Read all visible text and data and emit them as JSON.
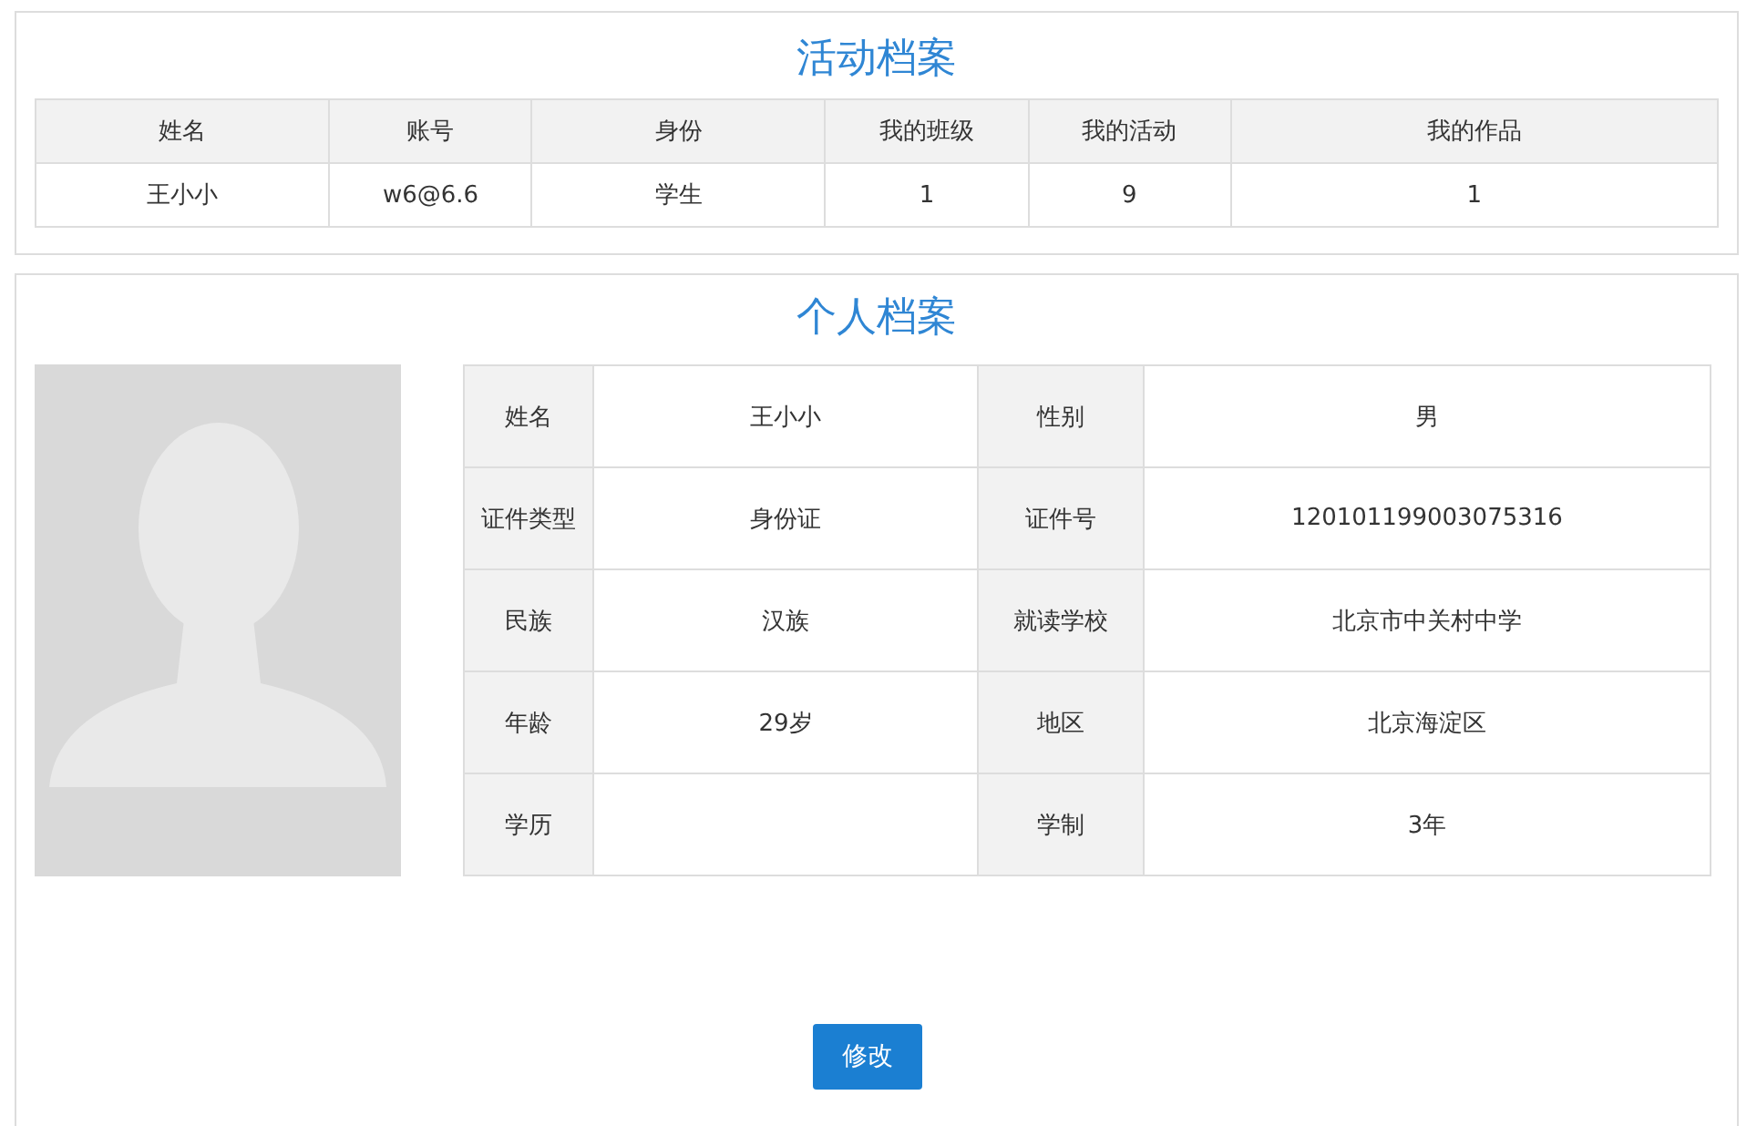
{
  "activity_archive": {
    "title": "活动档案",
    "columns": [
      "姓名",
      "账号",
      "身份",
      "我的班级",
      "我的活动",
      "我的作品"
    ],
    "row": [
      "王小小",
      "w6@6.6",
      "学生",
      "1",
      "9",
      "1"
    ]
  },
  "personal_archive": {
    "title": "个人档案",
    "rows": [
      {
        "label": "姓名",
        "value": "王小小",
        "label_2": "性别",
        "value_2": "男"
      },
      {
        "label": "证件类型",
        "value": "身份证",
        "label_2": "证件号",
        "value_2": "120101199003075316"
      },
      {
        "label": "民族",
        "value": "汉族",
        "label_2": "就读学校",
        "value_2": "北京市中关村中学"
      },
      {
        "label": "年龄",
        "value": "29岁",
        "label_2": "地区",
        "value_2": "北京海淀区"
      },
      {
        "label": "学历",
        "label_2": "学制",
        "value_2": "3年"
      }
    ],
    "edit_button": "修改"
  }
}
